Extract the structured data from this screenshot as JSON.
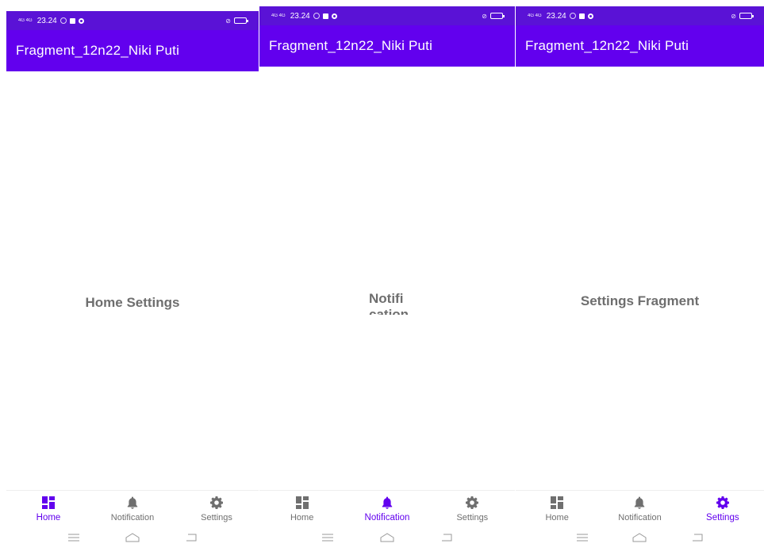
{
  "status_bar": {
    "network": "4G 4G",
    "time": "23.24"
  },
  "screens": [
    {
      "app_title": "Fragment_12n22_Niki Puti",
      "content_text": "Home Settings",
      "active_tab": "home"
    },
    {
      "app_title": "Fragment_12n22_Niki Puti",
      "content_text_line1": "Notifi",
      "content_text_line2": "cation",
      "active_tab": "notification"
    },
    {
      "app_title": "Fragment_12n22_Niki Puti",
      "content_text": "Settings Fragment",
      "active_tab": "settings"
    }
  ],
  "bottom_nav": {
    "items": [
      {
        "label": "Home",
        "icon": "dashboard-icon"
      },
      {
        "label": "Notification",
        "icon": "bell-icon"
      },
      {
        "label": "Settings",
        "icon": "gear-icon"
      }
    ]
  },
  "colors": {
    "primary": "#6200ee",
    "status_bar": "#5a12d6",
    "inactive": "#6f6f6f",
    "content_text": "#6e6e6e"
  }
}
